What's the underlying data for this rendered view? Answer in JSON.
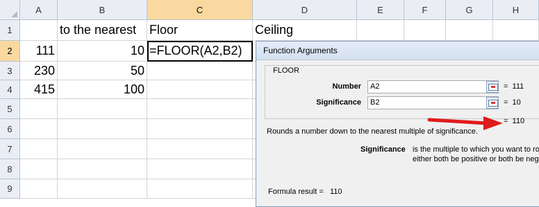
{
  "columns": [
    "A",
    "B",
    "C",
    "D",
    "E",
    "F",
    "G",
    "H"
  ],
  "rows": [
    "1",
    "2",
    "3",
    "4",
    "5",
    "6",
    "7",
    "8",
    "9"
  ],
  "cells": {
    "B1": "to the nearest",
    "C1": "Floor",
    "D1": "Ceiling",
    "A2": "111",
    "B2": "10",
    "C2": "=FLOOR(A2,B2)",
    "A3": "230",
    "B3": "50",
    "A4": "415",
    "B4": "100"
  },
  "dialog": {
    "title": "Function Arguments",
    "function_name": "FLOOR",
    "args": [
      {
        "label": "Number",
        "value": "A2",
        "result": "111"
      },
      {
        "label": "Significance",
        "value": "B2",
        "result": "10"
      }
    ],
    "overall_result": "110",
    "description": "Rounds a number down to the nearest multiple of significance.",
    "param_name": "Significance",
    "param_desc_line1": "is the multiple to which you want to ro",
    "param_desc_line2": "either both be positive or both be neg",
    "formula_result_label": "Formula result =",
    "formula_result_value": "110"
  },
  "colors": {
    "arrow": "#e01b1b",
    "selected_header": "#f9d99f",
    "header": "#eaeef4"
  }
}
